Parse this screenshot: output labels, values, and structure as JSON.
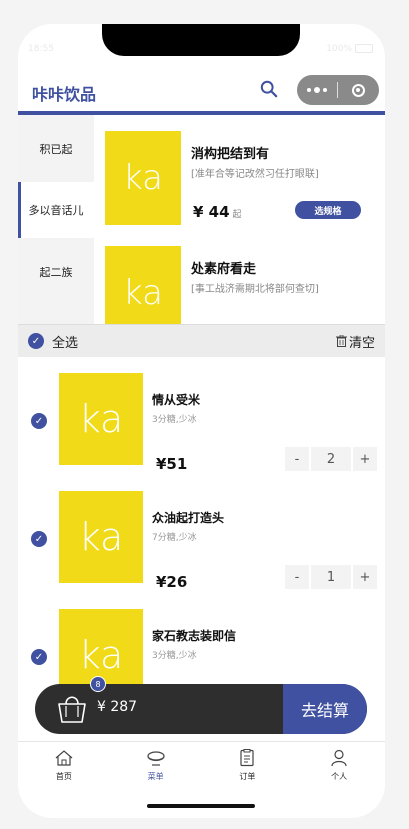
{
  "status": {
    "time": "18:55",
    "battery": "100%"
  },
  "header": {
    "title": "咔咔饮品"
  },
  "sidebar": {
    "items": [
      {
        "label": "积已起",
        "active": false
      },
      {
        "label": "多以音话儿",
        "active": true
      },
      {
        "label": "起二族",
        "active": false
      }
    ]
  },
  "products": [
    {
      "image_text": "ka",
      "name": "消构把结到有",
      "desc": "[准年合等记改然习任打眼联]",
      "price": "¥ 44",
      "price_suffix": "起",
      "button": "选规格"
    },
    {
      "image_text": "ka",
      "name": "处素府看走",
      "desc": "[事工战济需期北将部何查切]"
    }
  ],
  "cart": {
    "select_all": "全选",
    "clear": "清空",
    "items": [
      {
        "image_text": "ka",
        "name": "情从受米",
        "spec": "3分糖,少冰",
        "price": "¥51",
        "qty": "2",
        "minus": "-",
        "plus": "+"
      },
      {
        "image_text": "ka",
        "name": "众油起打造头",
        "spec": "7分糖,少冰",
        "price": "¥26",
        "qty": "1",
        "minus": "-",
        "plus": "+"
      },
      {
        "image_text": "ka",
        "name": "家石教志装即信",
        "spec": "3分糖,少冰"
      }
    ],
    "badge_count": "8",
    "total": "¥ 287",
    "checkout": "去结算"
  },
  "tabbar": {
    "items": [
      {
        "label": "首页",
        "icon": "home-icon"
      },
      {
        "label": "菜单",
        "icon": "menu-bowl-icon",
        "active": true
      },
      {
        "label": "订单",
        "icon": "order-icon"
      },
      {
        "label": "个人",
        "icon": "person-icon"
      }
    ]
  },
  "colors": {
    "brand": "#3f51a0",
    "image_bg": "#f1db18",
    "cart_bar": "#2e2e2e"
  }
}
